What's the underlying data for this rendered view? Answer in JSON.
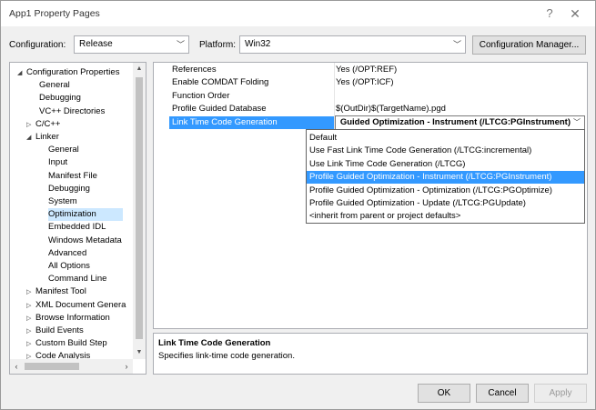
{
  "window": {
    "title": "App1 Property Pages",
    "help_glyph": "?",
    "close_glyph": "✕"
  },
  "toolbar": {
    "configuration_label": "Configuration:",
    "configuration_value": "Release",
    "platform_label": "Platform:",
    "platform_value": "Win32",
    "config_manager_label": "Configuration Manager..."
  },
  "tree": {
    "items": [
      {
        "label": "Configuration Properties",
        "toggle": "◢"
      },
      {
        "label": "General",
        "toggle": ""
      },
      {
        "label": "Debugging",
        "toggle": ""
      },
      {
        "label": "VC++ Directories",
        "toggle": ""
      },
      {
        "label": "C/C++",
        "toggle": "▷"
      },
      {
        "label": "Linker",
        "toggle": "◢"
      },
      {
        "label": "General",
        "toggle": ""
      },
      {
        "label": "Input",
        "toggle": ""
      },
      {
        "label": "Manifest File",
        "toggle": ""
      },
      {
        "label": "Debugging",
        "toggle": ""
      },
      {
        "label": "System",
        "toggle": ""
      },
      {
        "label": "Optimization",
        "toggle": ""
      },
      {
        "label": "Embedded IDL",
        "toggle": ""
      },
      {
        "label": "Windows Metadata",
        "toggle": ""
      },
      {
        "label": "Advanced",
        "toggle": ""
      },
      {
        "label": "All Options",
        "toggle": ""
      },
      {
        "label": "Command Line",
        "toggle": ""
      },
      {
        "label": "Manifest Tool",
        "toggle": "▷"
      },
      {
        "label": "XML Document Genera",
        "toggle": "▷"
      },
      {
        "label": "Browse Information",
        "toggle": "▷"
      },
      {
        "label": "Build Events",
        "toggle": "▷"
      },
      {
        "label": "Custom Build Step",
        "toggle": "▷"
      },
      {
        "label": "Code Analysis",
        "toggle": "▷"
      }
    ],
    "selected": "Optimization"
  },
  "properties": [
    {
      "name": "References",
      "value": "Yes (/OPT:REF)"
    },
    {
      "name": "Enable COMDAT Folding",
      "value": "Yes (/OPT:ICF)"
    },
    {
      "name": "Function Order",
      "value": ""
    },
    {
      "name": "Profile Guided Database",
      "value": "$(OutDir)$(TargetName).pgd"
    },
    {
      "name": "Link Time Code Generation",
      "value": ""
    }
  ],
  "combo_current": "Profile Guided Optimization - Instrument (/LTCG:PGInstrument)",
  "dropdown_options": [
    "Default",
    "Use Fast Link Time Code Generation (/LTCG:incremental)",
    "Use Link Time Code Generation (/LTCG)",
    "Profile Guided Optimization - Instrument (/LTCG:PGInstrument)",
    "Profile Guided Optimization - Optimization (/LTCG:PGOptimize)",
    "Profile Guided Optimization - Update (/LTCG:PGUpdate)",
    "<inherit from parent or project defaults>"
  ],
  "dropdown_selected": "Profile Guided Optimization - Instrument (/LTCG:PGInstrument)",
  "description": {
    "title": "Link Time Code Generation",
    "text": "Specifies link-time code generation."
  },
  "buttons": {
    "ok": "OK",
    "cancel": "Cancel",
    "apply": "Apply"
  }
}
